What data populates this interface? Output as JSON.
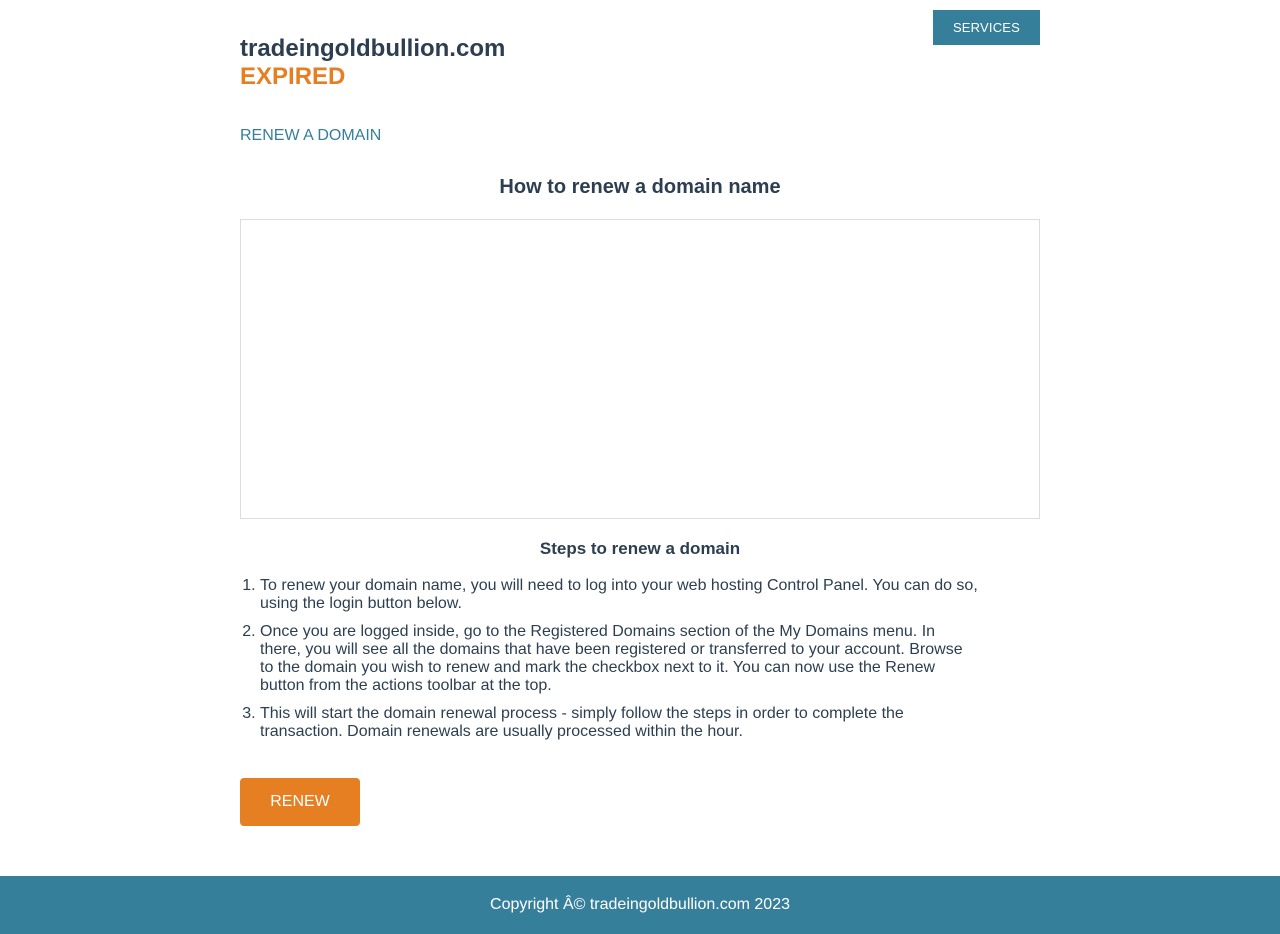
{
  "header": {
    "domain": "tradeingoldbullion.com",
    "status": "EXPIRED",
    "services_label": "SERVICES"
  },
  "nav": {
    "renew_link": "RENEW A DOMAIN"
  },
  "main": {
    "how_title": "How to renew a domain name",
    "steps_title": "Steps to renew a domain",
    "steps": [
      "To renew your domain name, you will need to log into your web hosting Control Panel. You can do so, using the login button below.",
      "Once you are logged inside, go to the Registered Domains section of the My Domains menu. In there, you will see all the domains that have been registered or transferred to your account. Browse to the domain you wish to renew and mark the checkbox next to it. You can now use the Renew button from the actions toolbar at the top.",
      "This will start the domain renewal process - simply follow the steps in order to complete the transaction. Domain renewals are usually processed within the hour."
    ],
    "renew_button": "RENEW"
  },
  "footer": {
    "copyright": "Copyright Â© tradeingoldbullion.com 2023"
  },
  "colors": {
    "accent": "#367f9b",
    "warning": "#e67e22",
    "text": "#2c3e50"
  }
}
